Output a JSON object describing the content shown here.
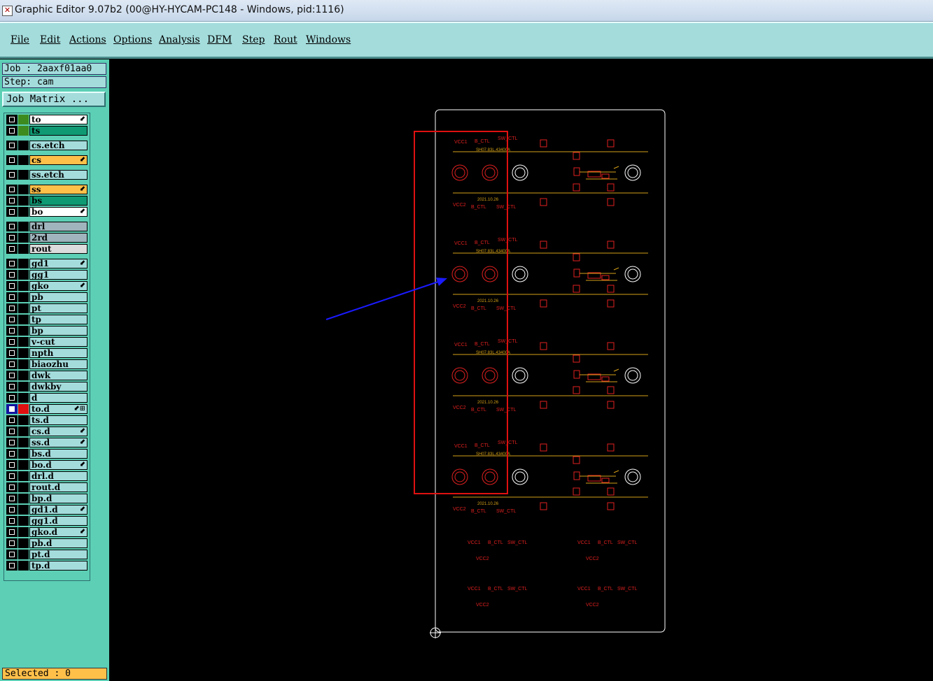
{
  "window": {
    "title": "Graphic Editor 9.07b2 (00@HY-HYCAM-PC148 - Windows, pid:1116)"
  },
  "menu": [
    "File",
    "Edit",
    "Actions",
    "Options",
    "Analysis",
    "DFM",
    "Step",
    "Rout",
    "Windows"
  ],
  "job": {
    "label": "Job : 2aaxf01aa0",
    "step": "Step: cam",
    "matrix_button": "Job Matrix ..."
  },
  "layers": [
    {
      "name": "to",
      "color": "#3d8a1e",
      "bg": "#ffffff",
      "mark": "⬋"
    },
    {
      "name": "ts",
      "color": "#3d8a1e",
      "bg": "#0f9a74",
      "mark": ""
    },
    {
      "name": "cs.etch",
      "color": "",
      "bg": "#a4dcdc",
      "mark": ""
    },
    {
      "name": "cs",
      "color": "",
      "bg": "#ffc04a",
      "mark": "⬋"
    },
    {
      "name": "ss.etch",
      "color": "",
      "bg": "#a4dcdc",
      "mark": ""
    },
    {
      "name": "ss",
      "color": "",
      "bg": "#ffc04a",
      "mark": "⬋"
    },
    {
      "name": "bs",
      "color": "",
      "bg": "#0f9a74",
      "mark": ""
    },
    {
      "name": "bo",
      "color": "",
      "bg": "#ffffff",
      "mark": "⬋"
    },
    {
      "name": "drl",
      "color": "",
      "bg": "#9fb4bc",
      "mark": ""
    },
    {
      "name": "2rd",
      "color": "",
      "bg": "#9fb4bc",
      "mark": ""
    },
    {
      "name": "rout",
      "color": "",
      "bg": "#dcdcdc",
      "mark": ""
    },
    {
      "name": "gd1",
      "color": "",
      "bg": "#a4dcdc",
      "mark": "⬋"
    },
    {
      "name": "gg1",
      "color": "",
      "bg": "#a4dcdc",
      "mark": ""
    },
    {
      "name": "gko",
      "color": "",
      "bg": "#a4dcdc",
      "mark": "⬋"
    },
    {
      "name": "pb",
      "color": "",
      "bg": "#a4dcdc",
      "mark": ""
    },
    {
      "name": "pt",
      "color": "",
      "bg": "#a4dcdc",
      "mark": ""
    },
    {
      "name": "tp",
      "color": "",
      "bg": "#a4dcdc",
      "mark": ""
    },
    {
      "name": "bp",
      "color": "",
      "bg": "#a4dcdc",
      "mark": ""
    },
    {
      "name": "v-cut",
      "color": "",
      "bg": "#a4dcdc",
      "mark": ""
    },
    {
      "name": "npth",
      "color": "",
      "bg": "#a4dcdc",
      "mark": ""
    },
    {
      "name": "biaozhu",
      "color": "",
      "bg": "#a4dcdc",
      "mark": ""
    },
    {
      "name": "dwk",
      "color": "",
      "bg": "#a4dcdc",
      "mark": ""
    },
    {
      "name": "dwkby",
      "color": "",
      "bg": "#a4dcdc",
      "mark": ""
    },
    {
      "name": "d",
      "color": "",
      "bg": "#a4dcdc",
      "mark": ""
    },
    {
      "name": "to.d",
      "color": "#e01010",
      "bg": "#a4dcdc",
      "mark": "⬋⊞",
      "active": true
    },
    {
      "name": "ts.d",
      "color": "",
      "bg": "#a4dcdc",
      "mark": ""
    },
    {
      "name": "cs.d",
      "color": "",
      "bg": "#a4dcdc",
      "mark": "⬋"
    },
    {
      "name": "ss.d",
      "color": "",
      "bg": "#a4dcdc",
      "mark": "⬋"
    },
    {
      "name": "bs.d",
      "color": "",
      "bg": "#a4dcdc",
      "mark": ""
    },
    {
      "name": "bo.d",
      "color": "",
      "bg": "#a4dcdc",
      "mark": "⬋"
    },
    {
      "name": "drl.d",
      "color": "",
      "bg": "#a4dcdc",
      "mark": ""
    },
    {
      "name": "rout.d",
      "color": "",
      "bg": "#a4dcdc",
      "mark": ""
    },
    {
      "name": "bp.d",
      "color": "",
      "bg": "#a4dcdc",
      "mark": ""
    },
    {
      "name": "gd1.d",
      "color": "",
      "bg": "#a4dcdc",
      "mark": "⬋"
    },
    {
      "name": "gg1.d",
      "color": "",
      "bg": "#a4dcdc",
      "mark": ""
    },
    {
      "name": "gko.d",
      "color": "",
      "bg": "#a4dcdc",
      "mark": "⬋"
    },
    {
      "name": "pb.d",
      "color": "",
      "bg": "#a4dcdc",
      "mark": ""
    },
    {
      "name": "pt.d",
      "color": "",
      "bg": "#a4dcdc",
      "mark": ""
    },
    {
      "name": "tp.d",
      "color": "",
      "bg": "#a4dcdc",
      "mark": ""
    }
  ],
  "status": {
    "selected": "Selected : 0"
  },
  "board": {
    "labels": {
      "vcc1": "VCC1",
      "vcc2": "VCC2",
      "b_ctl": "B_CTL",
      "sw_ctl": "SW_CTL",
      "part": "SH07.83L.43400A",
      "date": "2021.10.26"
    },
    "outline_color": "#ffffff",
    "trace_color": "#d4a017",
    "feature_color": "#e02020",
    "highlight_color": "#e01010",
    "arrow_color": "#1a1aff"
  }
}
